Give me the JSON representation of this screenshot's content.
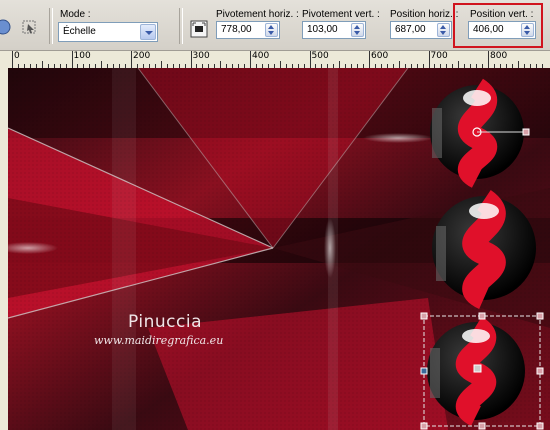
{
  "toolbar": {
    "mode": {
      "label": "Mode :",
      "value": "Échelle"
    },
    "pivot_h": {
      "label": "Pivotement horiz. :",
      "value": "778,00"
    },
    "pivot_v": {
      "label": "Pivotement vert. :",
      "value": "103,00"
    },
    "pos_h": {
      "label": "Position horiz. :",
      "value": "687,00"
    },
    "pos_v": {
      "label": "Position vert. :",
      "value": "406,00"
    },
    "highlight_color": "#d0141e"
  },
  "ruler": {
    "labels": [
      "0",
      "100",
      "200",
      "300",
      "400",
      "500",
      "600",
      "700",
      "800"
    ]
  },
  "canvas": {
    "watermark_name": "Pinuccia",
    "watermark_url": "www.maidiregrafica.eu",
    "colors": {
      "dark": "#1a0408",
      "red": "#c8102e",
      "gray": "#6b6b6b"
    }
  }
}
